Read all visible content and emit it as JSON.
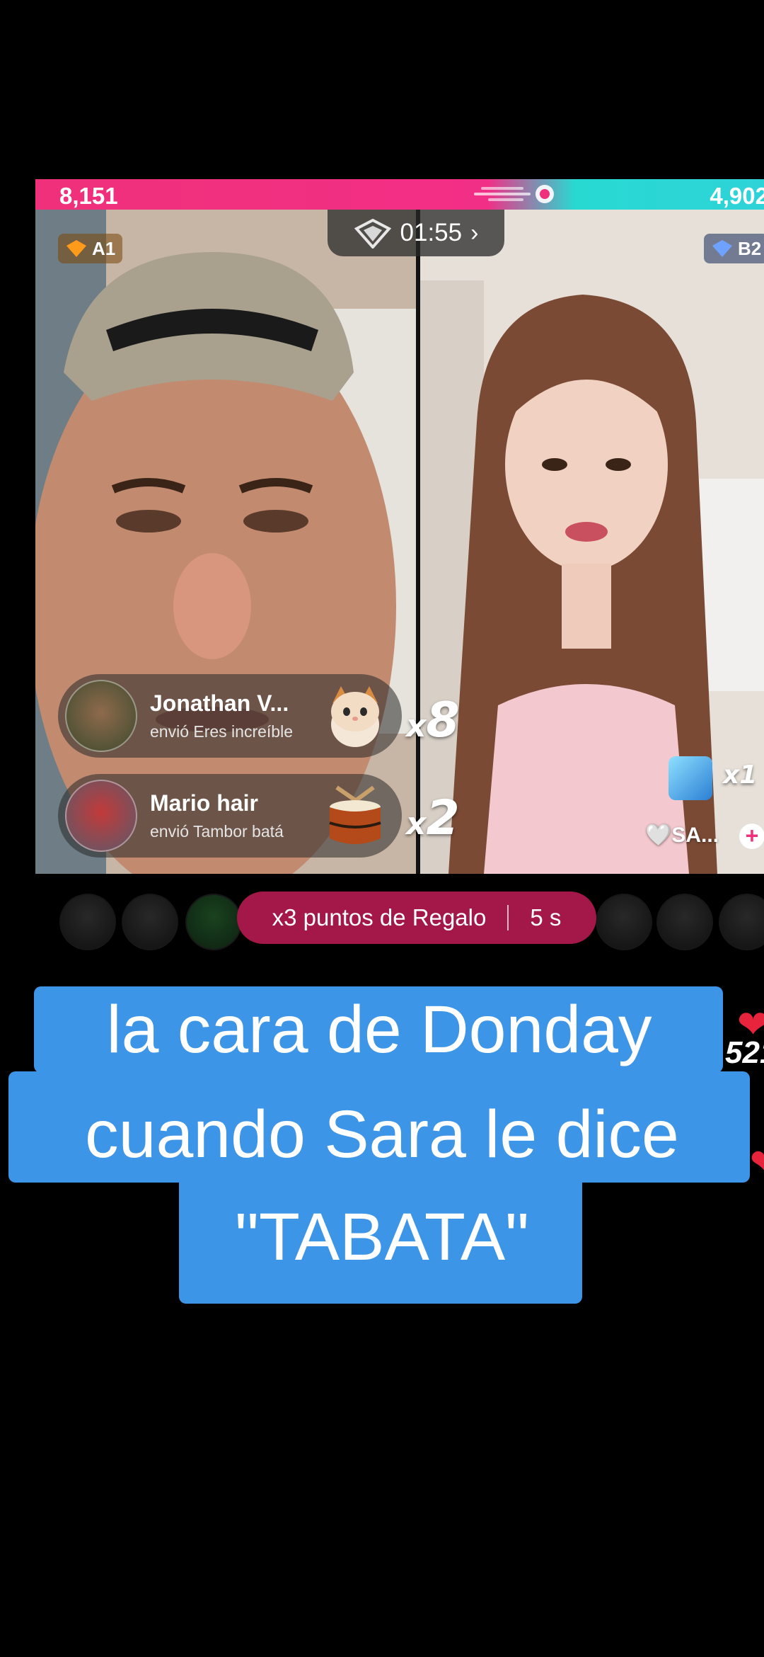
{
  "battle": {
    "score_left": "8,151",
    "score_right": "4,902",
    "timer": "01:55",
    "timer_chevron": "›",
    "team_a_label": "A1",
    "team_b_label": "B2",
    "left_color": "#f0307a",
    "right_color": "#2ed3d8"
  },
  "gifts": [
    {
      "name": "Jonathan V...",
      "description": "envió Eres increíble",
      "mult_x": "x",
      "mult_n": "8",
      "icon": "cat-gift-icon"
    },
    {
      "name": "Mario hair",
      "description": "envió Tambor batá",
      "mult_x": "x",
      "mult_n": "2",
      "icon": "drum-gift-icon"
    }
  ],
  "right_overlay": {
    "mult": "x1",
    "label": "🤍SA...",
    "plus": "+"
  },
  "bonus": {
    "text": "x3 puntos de Regalo",
    "time": "5 s"
  },
  "caption": {
    "line1": "la cara de Donday",
    "line2": "cuando Sara le dice",
    "line3": "\"TABATA\""
  },
  "side": {
    "number_fragment": "521"
  }
}
